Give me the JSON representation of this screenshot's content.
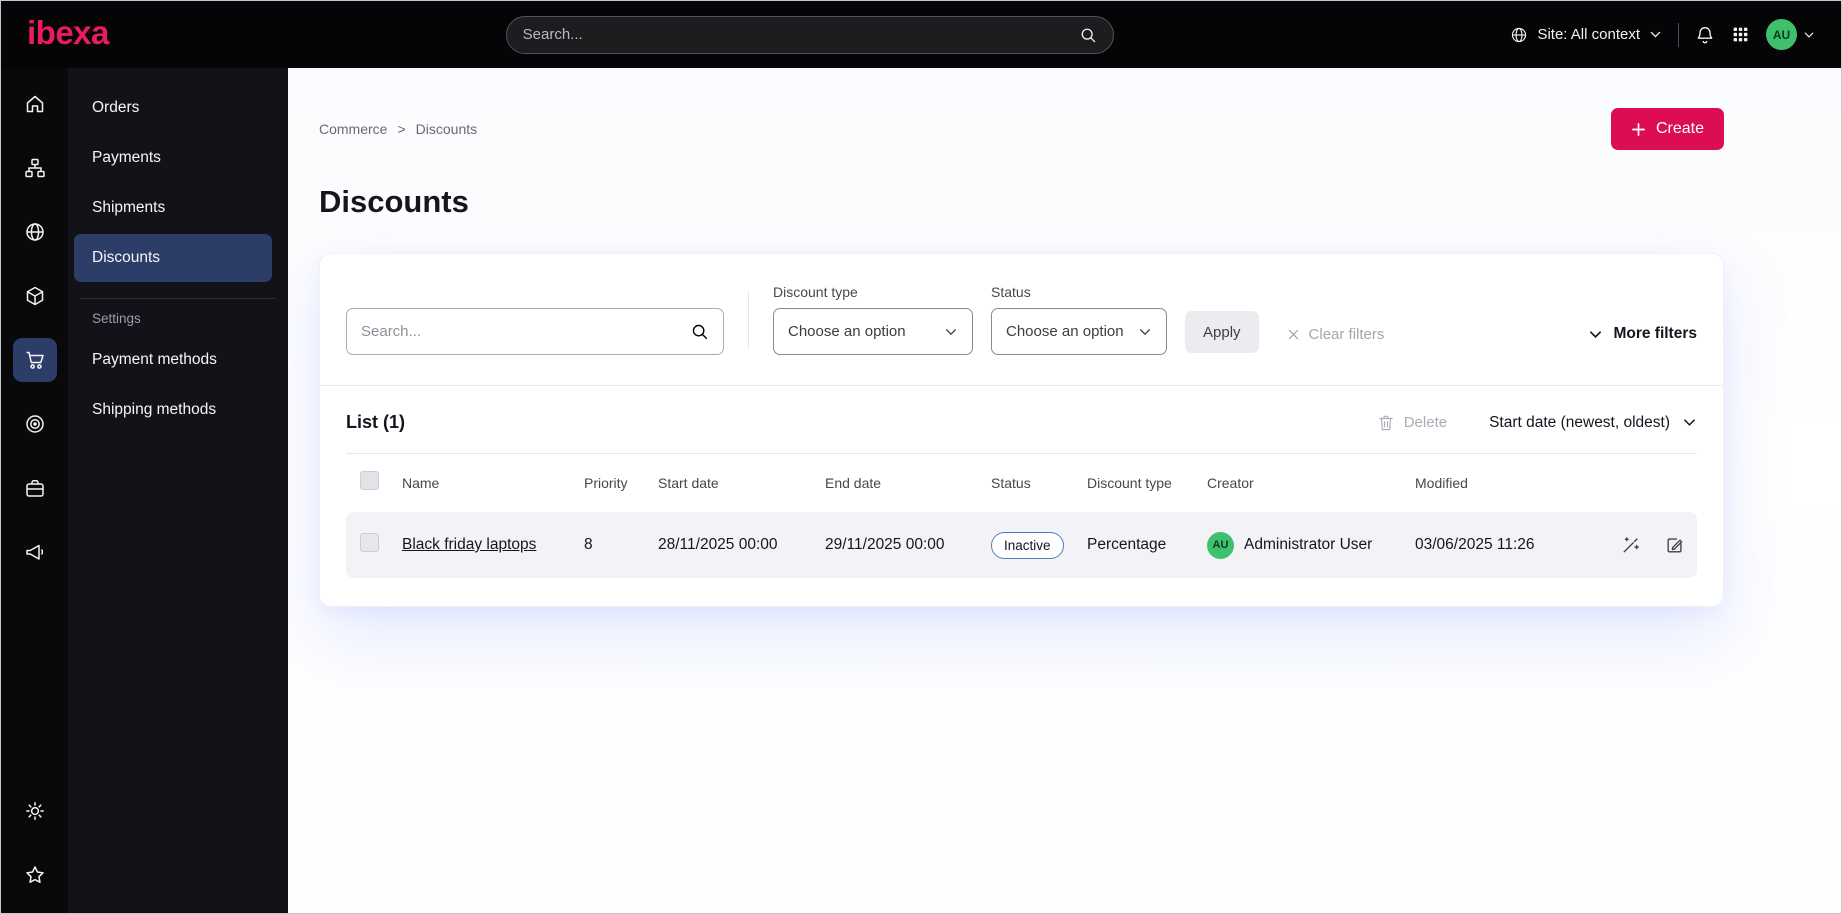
{
  "topbar": {
    "logo_text": "ibexa",
    "search_placeholder": "Search...",
    "site_context_label": "Site: All context",
    "avatar_initials": "AU"
  },
  "sidebar": {
    "menu": [
      {
        "label": "Orders"
      },
      {
        "label": "Payments"
      },
      {
        "label": "Shipments"
      },
      {
        "label": "Discounts"
      }
    ],
    "settings_section_label": "Settings",
    "settings_menu": [
      {
        "label": "Payment methods"
      },
      {
        "label": "Shipping methods"
      }
    ]
  },
  "breadcrumb": {
    "parent": "Commerce",
    "separator": ">",
    "current": "Discounts"
  },
  "page": {
    "title": "Discounts"
  },
  "actions": {
    "create_label": "Create"
  },
  "filters": {
    "search_placeholder": "Search...",
    "discount_type": {
      "label": "Discount type",
      "value": "Choose an option"
    },
    "status": {
      "label": "Status",
      "value": "Choose an option"
    },
    "apply_label": "Apply",
    "clear_label": "Clear filters",
    "more_filters_label": "More filters"
  },
  "list": {
    "title": "List (1)",
    "delete_label": "Delete",
    "sort_label": "Start date (newest, oldest)",
    "columns": [
      "Name",
      "Priority",
      "Start date",
      "End date",
      "Status",
      "Discount type",
      "Creator",
      "Modified"
    ],
    "rows": [
      {
        "name": "Black friday laptops",
        "priority": "8",
        "start_date": "28/11/2025 00:00",
        "end_date": "29/11/2025 00:00",
        "status": "Inactive",
        "discount_type": "Percentage",
        "creator_initials": "AU",
        "creator_name": "Administrator User",
        "modified": "03/06/2025 11:26"
      }
    ]
  },
  "colors": {
    "accent": "#dc0d52",
    "active_nav": "#2c3d68",
    "status_badge_border": "#4d7ec0",
    "avatar_green": "#3fc06c",
    "topbar_bg": "#050507"
  }
}
